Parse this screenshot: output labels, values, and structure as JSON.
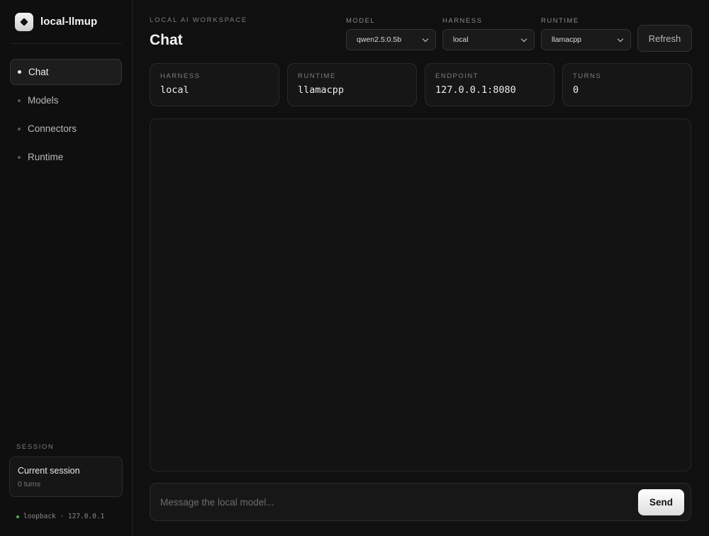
{
  "app": {
    "name": "local-llmup"
  },
  "sidebar": {
    "items": [
      {
        "label": "Chat",
        "active": true
      },
      {
        "label": "Models",
        "active": false
      },
      {
        "label": "Connectors",
        "active": false
      },
      {
        "label": "Runtime",
        "active": false
      }
    ],
    "session_label": "SESSION",
    "session_title": "Current session",
    "session_turns": "0 turns",
    "connection": "loopback · 127.0.0.1",
    "connection_color": "#4caf50"
  },
  "header": {
    "eyebrow": "LOCAL AI WORKSPACE",
    "title": "Chat"
  },
  "controls": {
    "model_label": "MODEL",
    "model_value": "qwen2.5:0.5b",
    "harness_label": "HARNESS",
    "harness_value": "local",
    "runtime_label": "RUNTIME",
    "runtime_value": "llamacpp",
    "refresh_label": "Refresh"
  },
  "stats": {
    "harness_label": "HARNESS",
    "harness_value": "local",
    "runtime_label": "RUNTIME",
    "runtime_value": "llamacpp",
    "endpoint_label": "ENDPOINT",
    "endpoint_value": "127.0.0.1:8080",
    "turns_label": "TURNS",
    "turns_value": "0"
  },
  "composer": {
    "placeholder": "Message the local model...",
    "send_label": "Send"
  },
  "icons": {
    "logo": "diamond-logo-icon",
    "dropdown": "chevron-down-icon",
    "nav_bullet": "dot-icon",
    "status": "status-dot-icon"
  },
  "colors": {
    "background": "#0c0c0c",
    "accent": "#f0f0f0",
    "status_ok": "#4caf50"
  }
}
